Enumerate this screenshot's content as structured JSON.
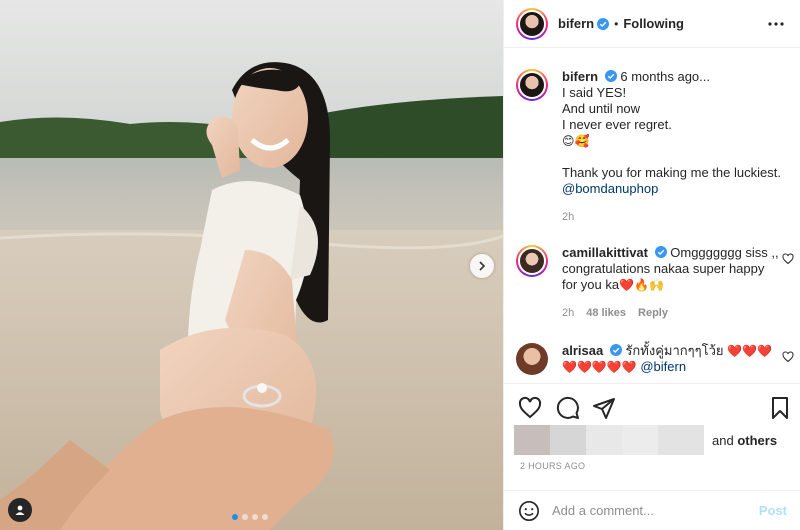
{
  "header": {
    "username": "bifern",
    "separator": "•",
    "follow_status": "Following"
  },
  "caption": {
    "username": "bifern",
    "age": "6 months ago...",
    "lines": [
      "I said YES!",
      "And until now",
      "I never ever regret."
    ],
    "emoji_line": "😊🥰",
    "thanks": "Thank you for making me the luckiest.",
    "mention": "@bomdanuphop",
    "time": "2h"
  },
  "comments": [
    {
      "username": "camillakittivat",
      "text": "Omggggggg siss ,, congratulations nakaa super happy for you ka",
      "emoji": "❤️🔥🙌",
      "time": "2h",
      "likes": "48 likes",
      "reply": "Reply"
    },
    {
      "username": "alrisaa",
      "text": "รักทั้งคู่มากๆๆโว้ย",
      "hearts_a": "❤️❤️❤️",
      "hearts_b": "❤️❤️❤️❤️❤️",
      "mention": "@bifern"
    }
  ],
  "likes": {
    "suffix": "and",
    "others": "others"
  },
  "timestamp": "2 HOURS AGO",
  "add_comment": {
    "placeholder": "Add a comment...",
    "post_label": "Post"
  },
  "carousel": {
    "count": 4,
    "active": 0
  },
  "colors": {
    "link": "#00376b",
    "accent": "#0095f6",
    "verified": "#3897f0",
    "post_disabled": "#b2dffc"
  }
}
